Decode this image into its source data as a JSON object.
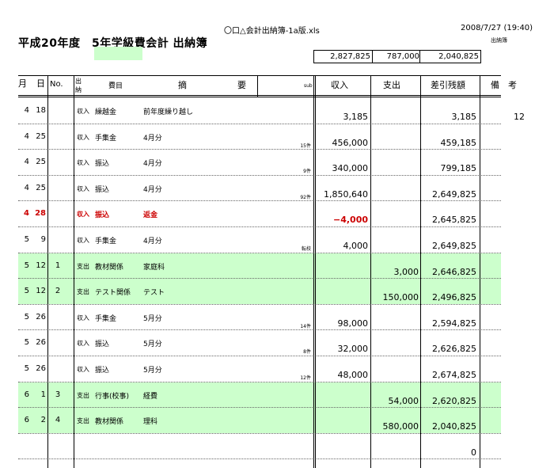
{
  "header": {
    "filename": "〇口△会計出納簿-1a版.xls",
    "datetime": "2008/7/27 (19:40)",
    "subtitle": "出納簿",
    "title": "平成20年度　5年学級費会計 出納簿"
  },
  "totals": {
    "income": "2,827,825",
    "expense": "787,000",
    "balance": "2,040,825"
  },
  "columns": {
    "month": "月",
    "day": "日",
    "no": "No.",
    "type_1": "出",
    "type_2": "納",
    "category": "費目",
    "desc_1": "摘",
    "desc_2": "要",
    "sub": "sub",
    "income": "収入",
    "expense": "支出",
    "balance": "差引残額",
    "note": "備　考"
  },
  "rows": [
    {
      "month": "4",
      "day": "18",
      "no": "",
      "type": "収入",
      "category": "繰越金",
      "desc": "前年度繰り越し",
      "sub": "",
      "income": "3,185",
      "expense": "",
      "balance": "3,185",
      "note": "12"
    },
    {
      "month": "4",
      "day": "25",
      "no": "",
      "type": "収入",
      "category": "手集金",
      "desc": "4月分",
      "sub": "15件",
      "income": "456,000",
      "expense": "",
      "balance": "459,185",
      "note": ""
    },
    {
      "month": "4",
      "day": "25",
      "no": "",
      "type": "収入",
      "category": "振込",
      "desc": "4月分",
      "sub": "9件",
      "income": "340,000",
      "expense": "",
      "balance": "799,185",
      "note": ""
    },
    {
      "month": "4",
      "day": "25",
      "no": "",
      "type": "収入",
      "category": "振込",
      "desc": "4月分",
      "sub": "92件",
      "income": "1,850,640",
      "expense": "",
      "balance": "2,649,825",
      "note": ""
    },
    {
      "month": "4",
      "day": "28",
      "no": "",
      "type": "収入",
      "category": "振込",
      "desc": "返金",
      "sub": "",
      "income": "−4,000",
      "expense": "",
      "balance": "2,645,825",
      "note": ""
    },
    {
      "month": "5",
      "day": "9",
      "no": "",
      "type": "収入",
      "category": "手集金",
      "desc": "4月分",
      "sub": "転校",
      "income": "4,000",
      "expense": "",
      "balance": "2,649,825",
      "note": ""
    },
    {
      "month": "5",
      "day": "12",
      "no": "1",
      "type": "支出",
      "category": "教材関係",
      "desc": "家庭科",
      "sub": "",
      "income": "",
      "expense": "3,000",
      "balance": "2,646,825",
      "note": ""
    },
    {
      "month": "5",
      "day": "12",
      "no": "2",
      "type": "支出",
      "category": "テスト関係",
      "desc": "テスト",
      "sub": "",
      "income": "",
      "expense": "150,000",
      "balance": "2,496,825",
      "note": ""
    },
    {
      "month": "5",
      "day": "26",
      "no": "",
      "type": "収入",
      "category": "手集金",
      "desc": "5月分",
      "sub": "14件",
      "income": "98,000",
      "expense": "",
      "balance": "2,594,825",
      "note": ""
    },
    {
      "month": "5",
      "day": "26",
      "no": "",
      "type": "収入",
      "category": "振込",
      "desc": "5月分",
      "sub": "8件",
      "income": "32,000",
      "expense": "",
      "balance": "2,626,825",
      "note": ""
    },
    {
      "month": "5",
      "day": "26",
      "no": "",
      "type": "収入",
      "category": "振込",
      "desc": "5月分",
      "sub": "12件",
      "income": "48,000",
      "expense": "",
      "balance": "2,674,825",
      "note": ""
    },
    {
      "month": "6",
      "day": "1",
      "no": "3",
      "type": "支出",
      "category": "行事(校事)",
      "desc": "経費",
      "sub": "",
      "income": "",
      "expense": "54,000",
      "balance": "2,620,825",
      "note": ""
    },
    {
      "month": "6",
      "day": "2",
      "no": "4",
      "type": "支出",
      "category": "教材関係",
      "desc": "理科",
      "sub": "",
      "income": "",
      "expense": "580,000",
      "balance": "2,040,825",
      "note": ""
    },
    {
      "month": "",
      "day": "",
      "no": "",
      "type": "",
      "category": "",
      "desc": "",
      "sub": "",
      "income": "",
      "expense": "",
      "balance": "0",
      "note": ""
    }
  ],
  "colors": {
    "highlight": "#ccffcc",
    "negative": "#cc0000"
  }
}
